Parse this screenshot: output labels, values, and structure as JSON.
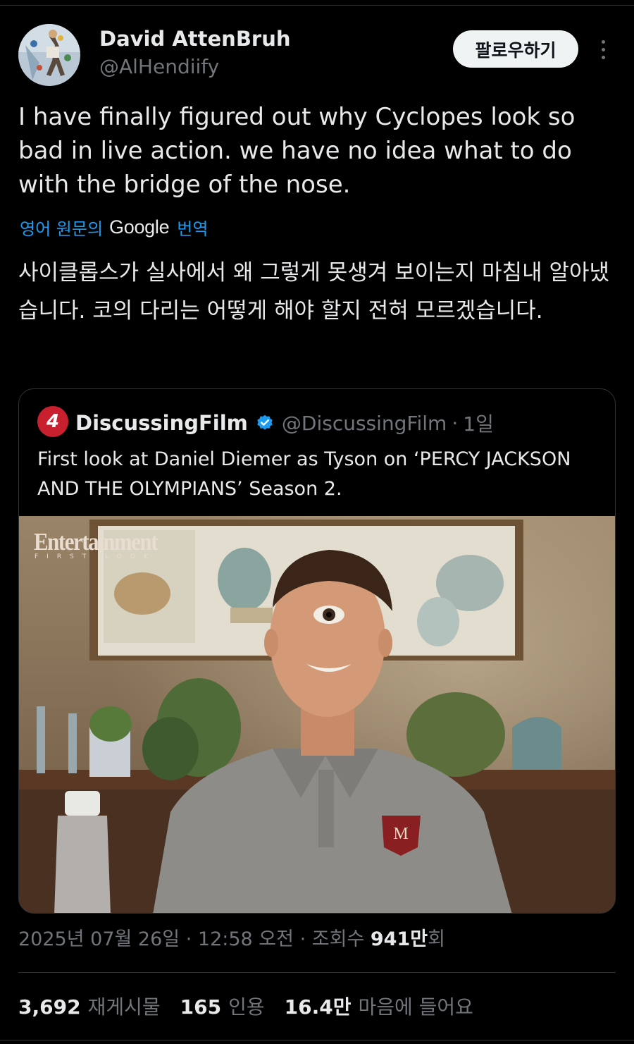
{
  "author": {
    "name": "David AttenBruh",
    "handle": "@AlHendiify",
    "follow_label": "팔로우하기"
  },
  "tweet": {
    "text": "I have finally figured out why Cyclopes look so bad in live action. we have no idea what to do with the bridge of the nose.",
    "translation": {
      "prefix": "영어 원문의",
      "provider": "Google",
      "suffix": "번역",
      "text": "사이클롭스가 실사에서 왜 그렇게 못생겨 보이는지 마침내 알아냈습니다. 코의 다리는 어떻게 해야 할지 전혀 모르겠습니다."
    }
  },
  "quote": {
    "logo_glyph": "4",
    "name": "DiscussingFilm",
    "handle": "@DiscussingFilm",
    "separator": "·",
    "time": "1일",
    "text": "First look at Daniel Diemer as Tyson on ‘PERCY JACKSON AND THE OLYMPIANS’ Season 2.",
    "media": {
      "brand": "Entertainment",
      "brand_sub": "FIRST LOOK",
      "patch_letter": "M"
    }
  },
  "meta": {
    "date": "2025년 07월 26일",
    "time": "12:58 오전",
    "views_label": "조회수",
    "views_value": "941만",
    "views_suffix": "회",
    "separator": "·"
  },
  "stats": {
    "retweets": {
      "value": "3,692",
      "label": "재게시물"
    },
    "quotes": {
      "value": "165",
      "label": "인용"
    },
    "likes": {
      "value": "16.4만",
      "label": "마음에 들어요"
    }
  },
  "colors": {
    "background": "#000000",
    "text": "#e7e9ea",
    "muted": "#71767b",
    "link": "#1d9bf0",
    "border": "#2f3336",
    "discussingfilm_red": "#c8202e"
  },
  "icons": [
    "verified-badge-icon",
    "more-options-icon",
    "discussingfilm-logo-icon"
  ]
}
